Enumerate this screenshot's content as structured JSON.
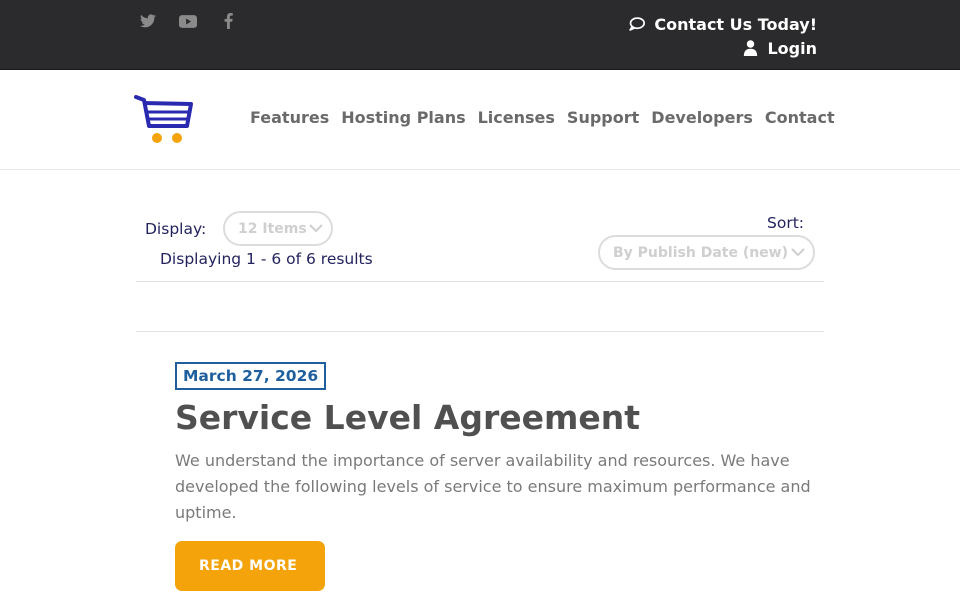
{
  "topbar": {
    "social": [
      {
        "icon": "twitter-icon",
        "color": "#8a8a8a"
      },
      {
        "icon": "youtube-icon",
        "color": "#8a8a8a"
      },
      {
        "icon": "facebook-icon",
        "color": "#8a8a8a"
      }
    ],
    "contact_label": "Contact Us Today!",
    "login_label": "Login",
    "background": "#2b2b2d"
  },
  "nav": {
    "logo_icon": "shopping-cart-icon",
    "items": [
      "Features",
      "Hosting Plans",
      "Licenses",
      "Support",
      "Developers",
      "Contact"
    ]
  },
  "controls": {
    "display_label": "Display:",
    "display_value": "12 Items",
    "results_text": "Displaying 1 - 6 of 6 results",
    "sort_label": "Sort:",
    "sort_value": "By Publish Date (new)"
  },
  "post": {
    "date": "March 27, 2026",
    "title": "Service Level Agreement",
    "excerpt": "We understand the importance of server availability and resources. We have developed the following levels of service to ensure maximum performance and uptime.",
    "read_more_label": "READ MORE"
  },
  "colors": {
    "accent": "#f5a30a",
    "date_border": "#1f5f9e",
    "logo_cart": "#2a2ab0",
    "logo_wheels": "#f5a30a"
  }
}
